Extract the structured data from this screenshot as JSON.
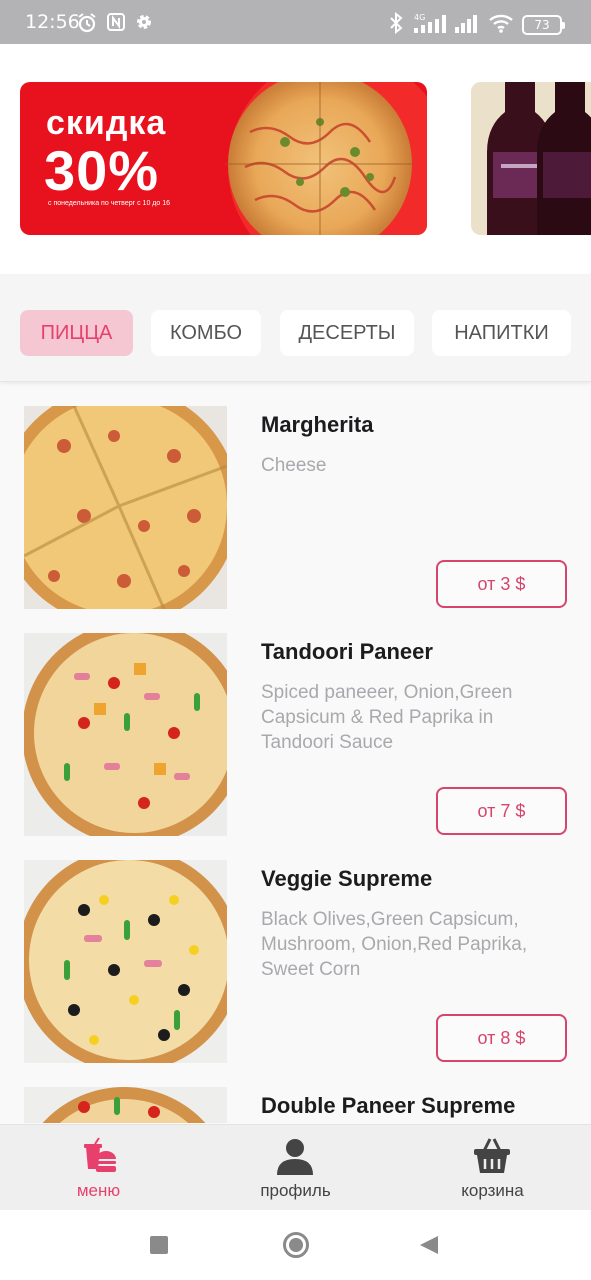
{
  "status_bar": {
    "time": "12:56",
    "battery": "73",
    "icons": [
      "alarm-icon",
      "nfc-icon",
      "settings-icon",
      "bluetooth-icon",
      "signal-4g-icon",
      "signal-icon",
      "wifi-icon",
      "battery-icon"
    ]
  },
  "banners": [
    {
      "title": "скидка",
      "percent": "30%",
      "note": "с понедельника по четверг с 10 до 16"
    }
  ],
  "tabs": [
    {
      "label": "ПИЦЦА",
      "active": true
    },
    {
      "label": "КОМБО",
      "active": false
    },
    {
      "label": "ДЕСЕРТЫ",
      "active": false
    },
    {
      "label": "НАПИТКИ",
      "active": false
    }
  ],
  "products": [
    {
      "name": "Margherita",
      "description": "Cheese",
      "price": "от 3 $"
    },
    {
      "name": "Tandoori Paneer",
      "description": "Spiced paneeer, Onion,Green Capsicum & Red Paprika in Tandoori Sauce",
      "price": "от 7 $"
    },
    {
      "name": "Veggie Supreme",
      "description": "Black Olives,Green Capsicum, Mushroom, Onion,Red Paprika, Sweet Corn",
      "price": "от 8 $"
    },
    {
      "name": "Double Paneer Supreme",
      "description": "",
      "price": ""
    }
  ],
  "bottom_nav": [
    {
      "label": "меню",
      "icon": "menu-food-icon",
      "active": true
    },
    {
      "label": "профиль",
      "icon": "profile-icon",
      "active": false
    },
    {
      "label": "корзина",
      "icon": "basket-icon",
      "active": false
    }
  ],
  "system_nav": [
    "recents-button",
    "home-button",
    "back-button"
  ],
  "colors": {
    "accent": "#e8406c",
    "banner_red": "#e8121e",
    "active_tab_bg": "#f5c7d2"
  }
}
